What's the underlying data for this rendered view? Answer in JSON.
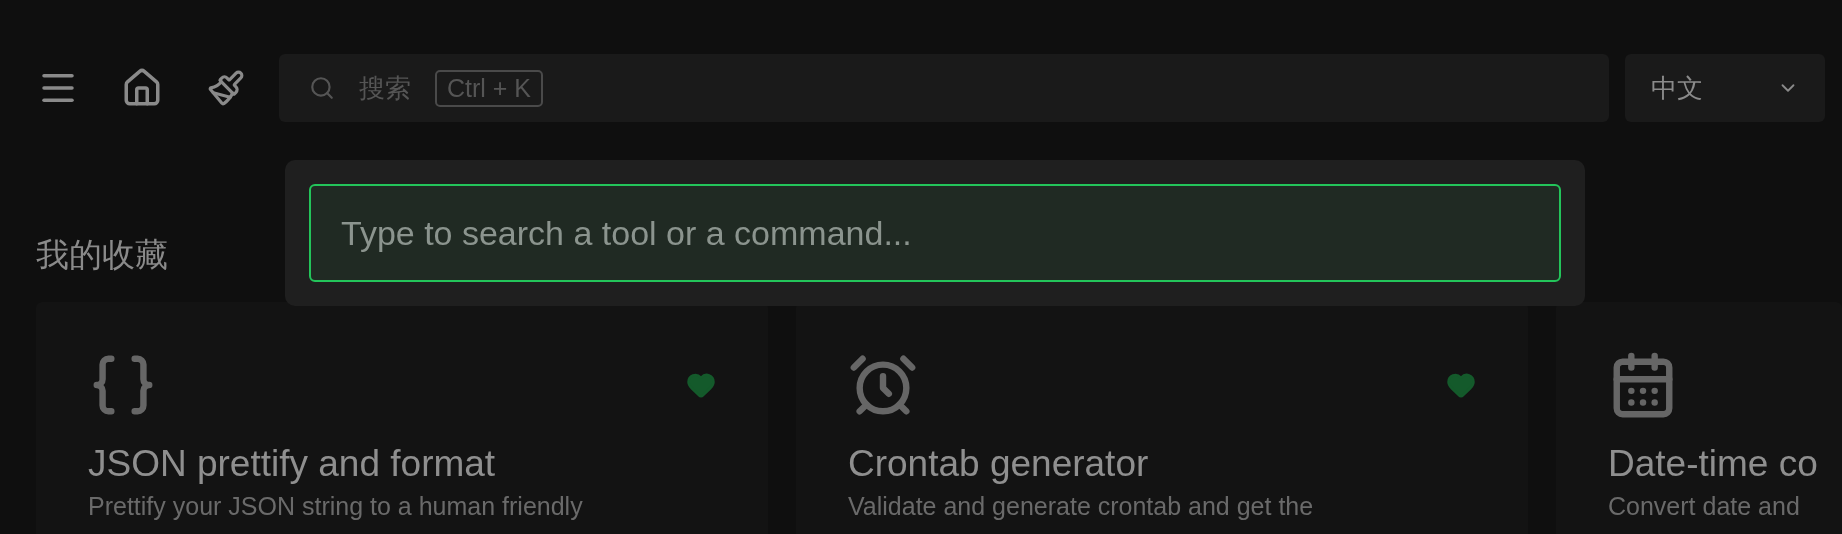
{
  "header": {
    "search": {
      "placeholder": "搜索",
      "shortcut": "Ctrl + K"
    },
    "language": {
      "value": "中文"
    }
  },
  "command_palette": {
    "placeholder": "Type to search a tool or a command..."
  },
  "favorites": {
    "title": "我的收藏",
    "tools": [
      {
        "kind": "braces",
        "name": "JSON prettify and format",
        "description": "Prettify your JSON string to a human friendly",
        "favorite": true
      },
      {
        "kind": "alarm",
        "name": "Crontab generator",
        "description": "Validate and generate crontab and get the",
        "favorite": true
      },
      {
        "kind": "calendar",
        "name": "Date-time co",
        "description": "Convert date and"
      }
    ]
  }
}
